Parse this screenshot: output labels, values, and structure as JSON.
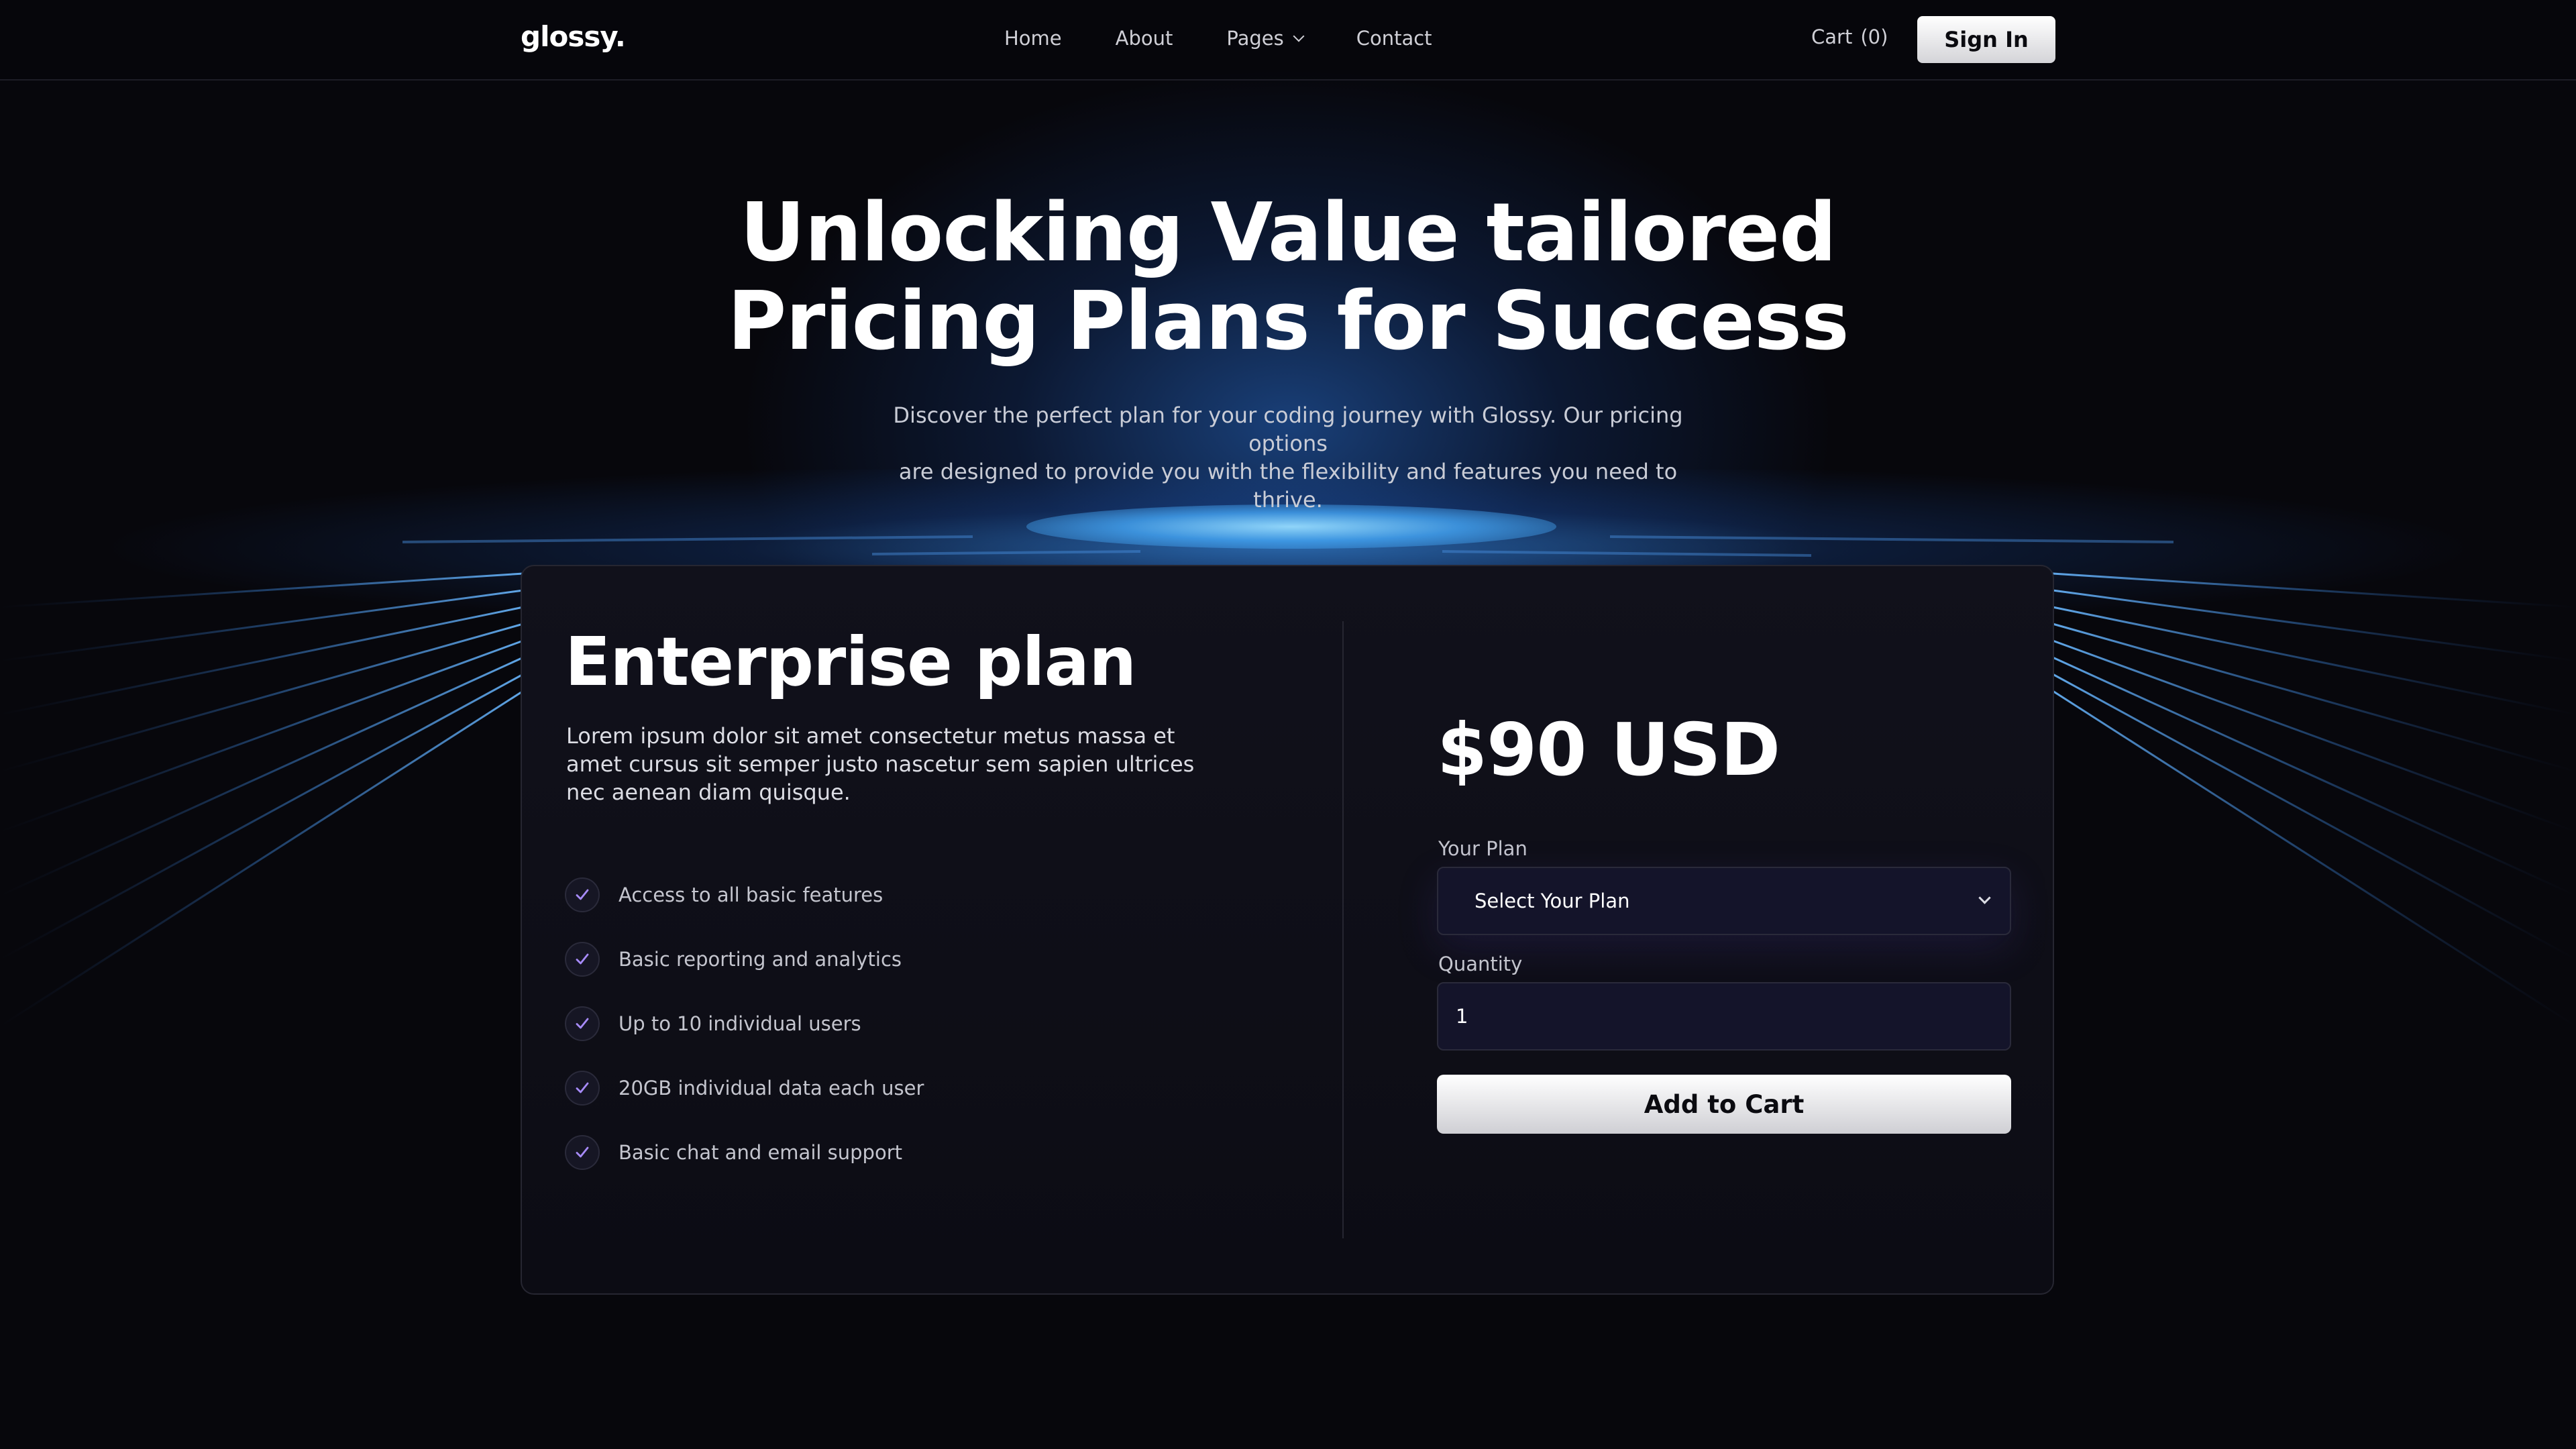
{
  "brand": {
    "logo_text": "glossy."
  },
  "nav": {
    "links": [
      {
        "label": "Home"
      },
      {
        "label": "About"
      },
      {
        "label": "Pages"
      },
      {
        "label": "Contact"
      }
    ],
    "cart_label": "Cart",
    "cart_count": "(0)",
    "signin_label": "Sign In"
  },
  "hero": {
    "title_line1": "Unlocking Value tailored",
    "title_line2": "Pricing Plans for Success",
    "subtitle_line1": "Discover the perfect plan for your coding journey with Glossy. Our pricing options",
    "subtitle_line2": "are designed to provide you with the flexibility and features you need to thrive."
  },
  "plan": {
    "title": "Enterprise plan",
    "description": "Lorem ipsum dolor sit amet consectetur metus massa et amet cursus sit semper justo nascetur sem sapien ultrices nec aenean diam quisque.",
    "features": [
      "Access to all basic features",
      "Basic reporting and analytics",
      "Up to 10 individual users",
      "20GB individual data each user",
      "Basic chat and email support"
    ],
    "feature_icon": "check-icon"
  },
  "checkout": {
    "price": "$90 USD",
    "plan_label": "Your Plan",
    "plan_select_value": "Select Your Plan",
    "quantity_label": "Quantity",
    "quantity_value": "1",
    "add_to_cart_label": "Add to Cart"
  },
  "colors": {
    "background": "#07070c",
    "card": "#11111b",
    "accent_glow": "#3aa0f5",
    "check": "#a78bfa",
    "button": "#ffffff"
  }
}
